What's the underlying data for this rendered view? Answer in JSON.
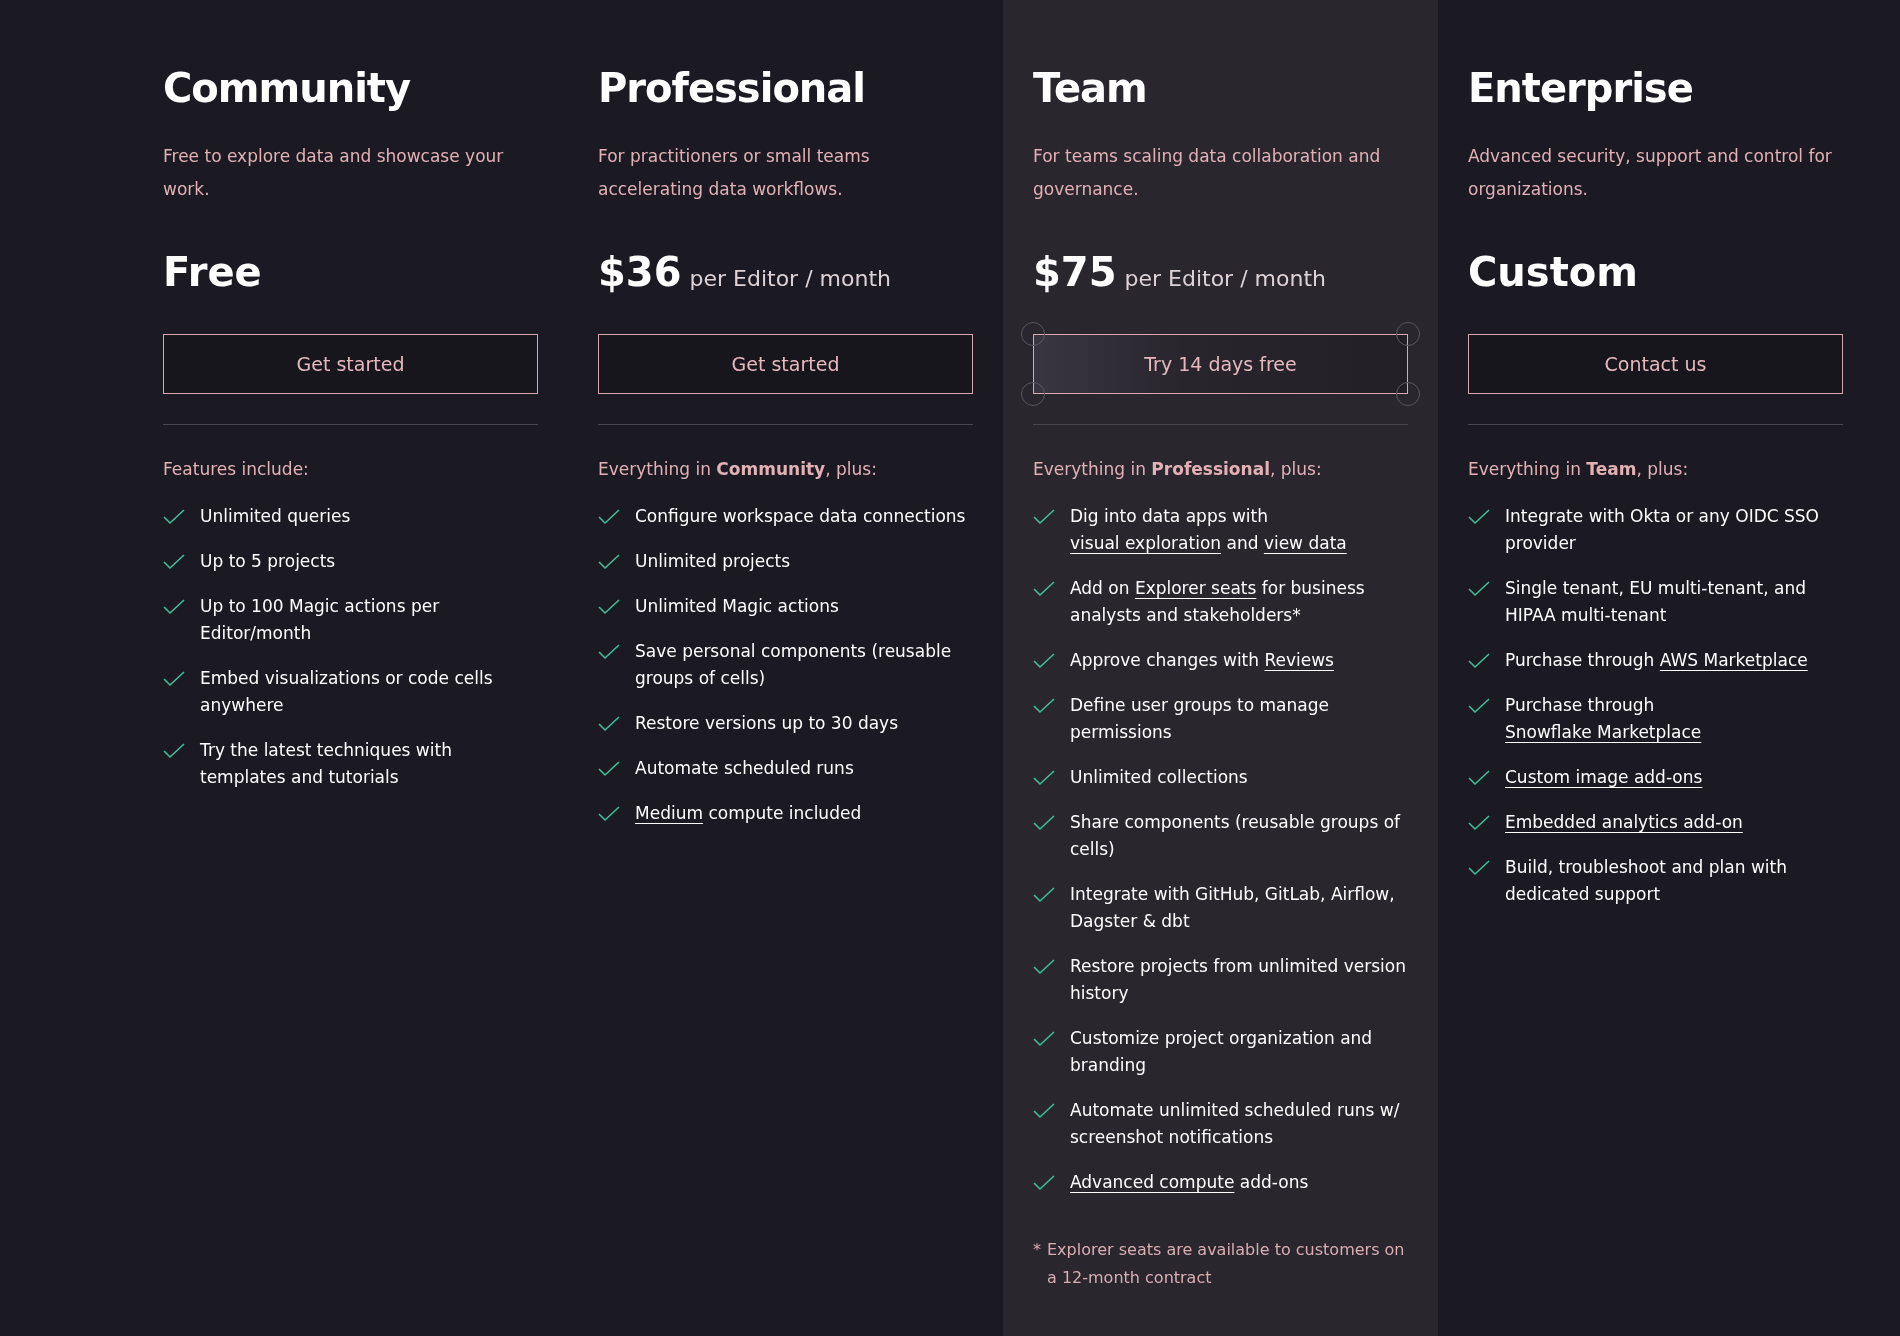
{
  "plans": [
    {
      "name": "Community",
      "highlighted": false,
      "description": "Free to explore data and showcase your work.",
      "price": {
        "amount": "Free"
      },
      "button": {
        "label": "Get started",
        "kind": "plain"
      },
      "features_heading": "Features include:",
      "features": [
        {
          "parts": [
            {
              "text": "Unlimited queries",
              "link": false
            }
          ]
        },
        {
          "parts": [
            {
              "text": "Up to 5 projects",
              "link": false
            }
          ]
        },
        {
          "parts": [
            {
              "text": "Up to 100 Magic actions per Editor/month",
              "link": false
            }
          ]
        },
        {
          "parts": [
            {
              "text": "Embed visualizations or code cells anywhere",
              "link": false
            }
          ]
        },
        {
          "parts": [
            {
              "text": "Try the latest techniques with templates and tutorials",
              "link": false
            }
          ]
        }
      ]
    },
    {
      "name": "Professional",
      "highlighted": false,
      "description": "For practitioners or small teams accelerating data workflows.",
      "price": {
        "amount": "$36",
        "unit": "per Editor / month"
      },
      "button": {
        "label": "Get started",
        "kind": "plain"
      },
      "features_heading": "Everything in **Community**, plus:",
      "features": [
        {
          "parts": [
            {
              "text": "Configure workspace data connections",
              "link": false
            }
          ]
        },
        {
          "parts": [
            {
              "text": "Unlimited projects",
              "link": false
            }
          ]
        },
        {
          "parts": [
            {
              "text": "Unlimited Magic actions",
              "link": false
            }
          ]
        },
        {
          "parts": [
            {
              "text": "Save personal components (reusable groups of cells)",
              "link": false
            }
          ]
        },
        {
          "parts": [
            {
              "text": "Restore versions up to 30 days",
              "link": false
            }
          ]
        },
        {
          "parts": [
            {
              "text": "Automate scheduled runs",
              "link": false
            }
          ]
        },
        {
          "parts": [
            {
              "text": "Medium",
              "link": true
            },
            {
              "text": " compute included",
              "link": false
            }
          ]
        }
      ]
    },
    {
      "name": "Team",
      "highlighted": true,
      "description": "For teams scaling data collaboration and governance.",
      "price": {
        "amount": "$75",
        "unit": "per Editor / month"
      },
      "button": {
        "label": "Try 14 days free",
        "kind": "trial"
      },
      "features_heading": "Everything in **Professional**, plus:",
      "features": [
        {
          "parts": [
            {
              "text": "Dig into data apps with ",
              "link": false
            },
            {
              "text": "visual exploration",
              "link": true
            },
            {
              "text": " and ",
              "link": false
            },
            {
              "text": "view data",
              "link": true
            }
          ]
        },
        {
          "parts": [
            {
              "text": "Add on ",
              "link": false
            },
            {
              "text": "Explorer seats",
              "link": true
            },
            {
              "text": " for business analysts and stakeholders*",
              "link": false
            }
          ]
        },
        {
          "parts": [
            {
              "text": "Approve changes with ",
              "link": false
            },
            {
              "text": "Reviews",
              "link": true
            }
          ]
        },
        {
          "parts": [
            {
              "text": "Define user groups to manage permissions",
              "link": false
            }
          ]
        },
        {
          "parts": [
            {
              "text": "Unlimited collections",
              "link": false
            }
          ]
        },
        {
          "parts": [
            {
              "text": "Share components (reusable groups of cells)",
              "link": false
            }
          ]
        },
        {
          "parts": [
            {
              "text": "Integrate with GitHub, GitLab, Airflow, Dagster & dbt",
              "link": false
            }
          ]
        },
        {
          "parts": [
            {
              "text": "Restore projects from unlimited version history",
              "link": false
            }
          ]
        },
        {
          "parts": [
            {
              "text": "Customize project organization and branding",
              "link": false
            }
          ]
        },
        {
          "parts": [
            {
              "text": "Automate unlimited scheduled runs w/ screenshot notifications",
              "link": false
            }
          ]
        },
        {
          "parts": [
            {
              "text": "Advanced compute",
              "link": true
            },
            {
              "text": " add-ons",
              "link": false
            }
          ]
        }
      ],
      "footnote": {
        "mark": "*",
        "text": "Explorer seats are available to customers on a 12-month contract"
      }
    },
    {
      "name": "Enterprise",
      "highlighted": false,
      "description": "Advanced security, support and control for organizations.",
      "price": {
        "amount": "Custom"
      },
      "button": {
        "label": "Contact us",
        "kind": "plain"
      },
      "features_heading": "Everything in **Team**, plus:",
      "features": [
        {
          "parts": [
            {
              "text": "Integrate with Okta or any OIDC SSO provider",
              "link": false
            }
          ]
        },
        {
          "parts": [
            {
              "text": "Single tenant, EU multi-tenant, and HIPAA multi-tenant",
              "link": false
            }
          ]
        },
        {
          "parts": [
            {
              "text": "Purchase through ",
              "link": false
            },
            {
              "text": "AWS Marketplace",
              "link": true
            }
          ]
        },
        {
          "parts": [
            {
              "text": "Purchase through ",
              "link": false
            },
            {
              "text": "Snowflake Marketplace",
              "link": true
            }
          ]
        },
        {
          "parts": [
            {
              "text": "Custom image add-ons",
              "link": true
            }
          ]
        },
        {
          "parts": [
            {
              "text": "Embedded analytics add-on",
              "link": true
            }
          ]
        },
        {
          "parts": [
            {
              "text": "Build, troubleshoot and plan with dedicated support",
              "link": false
            }
          ]
        }
      ]
    }
  ]
}
